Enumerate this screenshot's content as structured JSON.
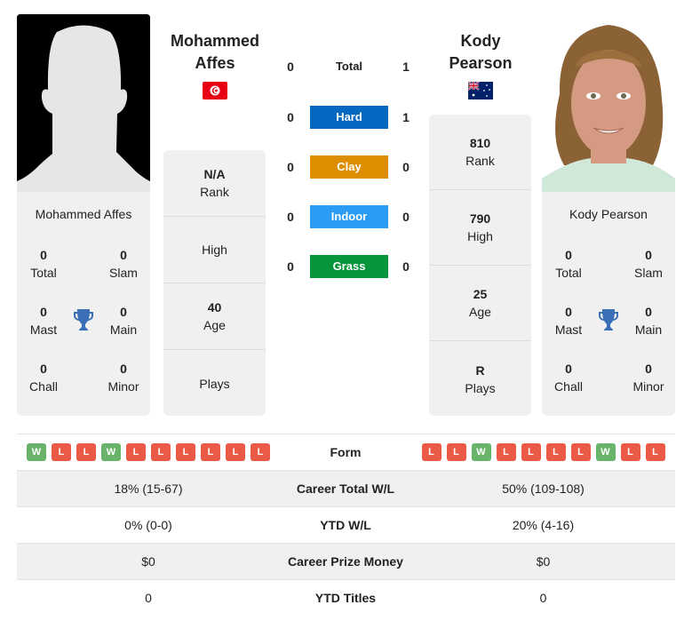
{
  "colors": {
    "hard": "#0468c0",
    "clay": "#dd8d00",
    "indoor": "#2b9bf3",
    "grass": "#07953c",
    "win": "#69b46a",
    "loss": "#ea5a47",
    "trophy": "#3b6fb6"
  },
  "player1": {
    "name": "Mohammed Affes",
    "name_line1": "Mohammed",
    "name_line2": "Affes",
    "flag": "tunisia-flag",
    "photo": "silhouette-placeholder",
    "titles": {
      "total": {
        "value": "0",
        "label": "Total"
      },
      "slam": {
        "value": "0",
        "label": "Slam"
      },
      "mast": {
        "value": "0",
        "label": "Mast"
      },
      "main": {
        "value": "0",
        "label": "Main"
      },
      "chall": {
        "value": "0",
        "label": "Chall"
      },
      "minor": {
        "value": "0",
        "label": "Minor"
      }
    },
    "info": [
      {
        "value": "N/A",
        "label": "Rank"
      },
      {
        "value": "",
        "label": "High"
      },
      {
        "value": "40",
        "label": "Age"
      },
      {
        "value": "",
        "label": "Plays"
      }
    ],
    "form": [
      "W",
      "L",
      "L",
      "W",
      "L",
      "L",
      "L",
      "L",
      "L",
      "L"
    ]
  },
  "player2": {
    "name": "Kody Pearson",
    "name_line1": "Kody",
    "name_line2": "Pearson",
    "flag": "australia-flag",
    "photo": "player-headshot",
    "titles": {
      "total": {
        "value": "0",
        "label": "Total"
      },
      "slam": {
        "value": "0",
        "label": "Slam"
      },
      "mast": {
        "value": "0",
        "label": "Mast"
      },
      "main": {
        "value": "0",
        "label": "Main"
      },
      "chall": {
        "value": "0",
        "label": "Chall"
      },
      "minor": {
        "value": "0",
        "label": "Minor"
      }
    },
    "info": [
      {
        "value": "810",
        "label": "Rank"
      },
      {
        "value": "790",
        "label": "High"
      },
      {
        "value": "25",
        "label": "Age"
      },
      {
        "value": "R",
        "label": "Plays"
      }
    ],
    "form": [
      "L",
      "L",
      "W",
      "L",
      "L",
      "L",
      "L",
      "W",
      "L",
      "L"
    ]
  },
  "h2h": [
    {
      "label": "Total",
      "p1": "0",
      "p2": "1",
      "surface": "total"
    },
    {
      "label": "Hard",
      "p1": "0",
      "p2": "1",
      "surface": "hard"
    },
    {
      "label": "Clay",
      "p1": "0",
      "p2": "0",
      "surface": "clay"
    },
    {
      "label": "Indoor",
      "p1": "0",
      "p2": "0",
      "surface": "indoor"
    },
    {
      "label": "Grass",
      "p1": "0",
      "p2": "0",
      "surface": "grass"
    }
  ],
  "comparison": {
    "form_label": "Form",
    "rows": [
      {
        "label": "Career Total W/L",
        "p1": "18% (15-67)",
        "p2": "50% (109-108)"
      },
      {
        "label": "YTD W/L",
        "p1": "0% (0-0)",
        "p2": "20% (4-16)"
      },
      {
        "label": "Career Prize Money",
        "p1": "$0",
        "p2": "$0"
      },
      {
        "label": "YTD Titles",
        "p1": "0",
        "p2": "0"
      }
    ]
  }
}
